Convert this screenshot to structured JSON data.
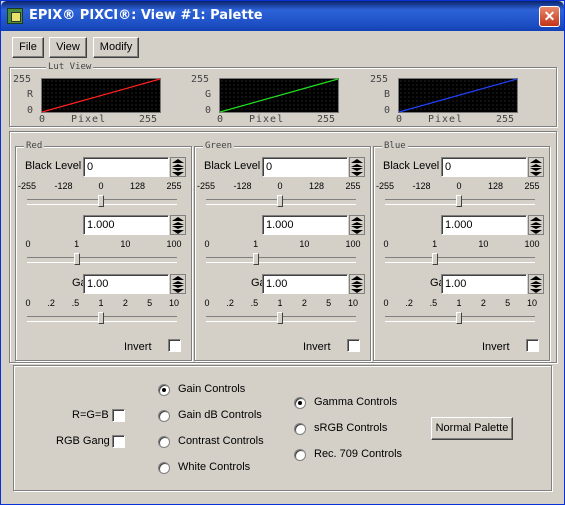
{
  "window": {
    "title": "EPIX® PIXCI®: View #1: Palette",
    "close_glyph": "✕"
  },
  "menu": [
    {
      "label": "File"
    },
    {
      "label": "View"
    },
    {
      "label": "Modify"
    }
  ],
  "lut_view": {
    "legend": "Lut View",
    "x_label": "Pixel",
    "x_min": "0",
    "x_max": "255",
    "y_min": "0",
    "y_max": "255",
    "charts": [
      {
        "channel": "R",
        "color": "#ff2020",
        "curve": [
          [
            0,
            0
          ],
          [
            255,
            255
          ]
        ]
      },
      {
        "channel": "G",
        "color": "#20e020",
        "curve": [
          [
            0,
            0
          ],
          [
            255,
            255
          ]
        ]
      },
      {
        "channel": "B",
        "color": "#2040ff",
        "curve": [
          [
            0,
            0
          ],
          [
            255,
            255
          ]
        ]
      }
    ]
  },
  "channels": [
    {
      "name": "Red",
      "black_level": {
        "label": "Black Level",
        "value": "0"
      },
      "gain": {
        "label": "Gain",
        "value": "1.000"
      },
      "gamma": {
        "label": "Gamma",
        "value": "1.00"
      },
      "invert": {
        "label": "Invert",
        "checked": false
      }
    },
    {
      "name": "Green",
      "black_level": {
        "label": "Black Level",
        "value": "0"
      },
      "gain": {
        "label": "Gain",
        "value": "1.000"
      },
      "gamma": {
        "label": "Gamma",
        "value": "1.00"
      },
      "invert": {
        "label": "Invert",
        "checked": false
      }
    },
    {
      "name": "Blue",
      "black_level": {
        "label": "Black Level",
        "value": "0"
      },
      "gain": {
        "label": "Gain",
        "value": "1.000"
      },
      "gamma": {
        "label": "Gamma",
        "value": "1.00"
      },
      "invert": {
        "label": "Invert",
        "checked": false
      }
    }
  ],
  "scales": {
    "black_level": [
      "-255",
      "-128",
      "0",
      "128",
      "255"
    ],
    "gain": [
      "0",
      "1",
      "10",
      "100"
    ],
    "gamma": [
      "0",
      ".2",
      ".5",
      "1",
      "2",
      "5",
      "10"
    ]
  },
  "options": {
    "rgb_equal": {
      "label": "R=G=B",
      "checked": false
    },
    "rgb_gang": {
      "label": "RGB Gang",
      "checked": false
    },
    "control_modes": [
      {
        "label": "Gain Controls",
        "selected": true
      },
      {
        "label": "Gain dB Controls",
        "selected": false
      },
      {
        "label": "Contrast Controls",
        "selected": false
      },
      {
        "label": "White Controls",
        "selected": false
      }
    ],
    "gamma_modes": [
      {
        "label": "Gamma Controls",
        "selected": true
      },
      {
        "label": "sRGB Controls",
        "selected": false
      },
      {
        "label": "Rec. 709 Controls",
        "selected": false
      }
    ],
    "normal_palette": "Normal Palette"
  }
}
